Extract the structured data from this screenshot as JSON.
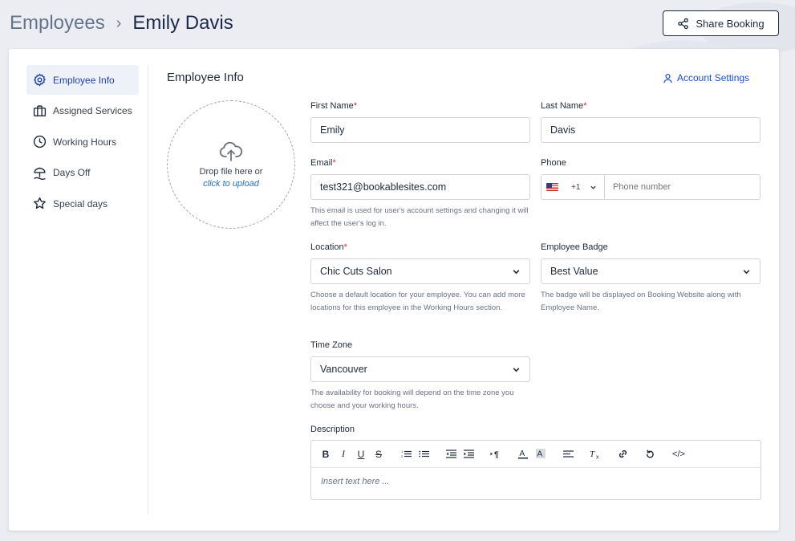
{
  "breadcrumb": {
    "parent": "Employees",
    "separator": "›",
    "current": "Emily Davis"
  },
  "share_button": {
    "label": "Share Booking"
  },
  "sidebar": {
    "items": [
      {
        "label": "Employee Info",
        "icon": "gear-icon",
        "active": true
      },
      {
        "label": "Assigned Services",
        "icon": "briefcase-icon",
        "active": false
      },
      {
        "label": "Working Hours",
        "icon": "clock-icon",
        "active": false
      },
      {
        "label": "Days Off",
        "icon": "beach-umbrella-icon",
        "active": false
      },
      {
        "label": "Special days",
        "icon": "star-icon",
        "active": false
      }
    ]
  },
  "section": {
    "title": "Employee Info",
    "account_settings_label": "Account Settings"
  },
  "upload": {
    "text": "Drop file here or",
    "link": "click to upload"
  },
  "form": {
    "first_name": {
      "label": "First Name",
      "required": "*",
      "value": "Emily"
    },
    "last_name": {
      "label": "Last Name",
      "required": "*",
      "value": "Davis"
    },
    "email": {
      "label": "Email",
      "required": "*",
      "value": "test321@bookablesites.com",
      "help": "This email is used for user's account settings and changing it will affect the user's log in."
    },
    "phone": {
      "label": "Phone",
      "country_code": "+1",
      "placeholder": "Phone number"
    },
    "location": {
      "label": "Location",
      "required": "*",
      "value": "Chic Cuts Salon",
      "help": "Choose a default location for your employee. You can add more locations for this employee in the Working Hours section."
    },
    "badge": {
      "label": "Employee Badge",
      "value": "Best Value",
      "help": "The badge will be displayed on Booking Website along with Employee Name."
    },
    "timezone": {
      "label": "Time Zone",
      "value": "Vancouver",
      "help": "The availability for booking will depend on the time zone you choose and your working hours."
    },
    "description": {
      "label": "Description",
      "placeholder": "Insert text here ..."
    }
  },
  "colors": {
    "accent": "#1d4ed8",
    "required": "#dc2626",
    "active_bg": "#eef2f8"
  }
}
